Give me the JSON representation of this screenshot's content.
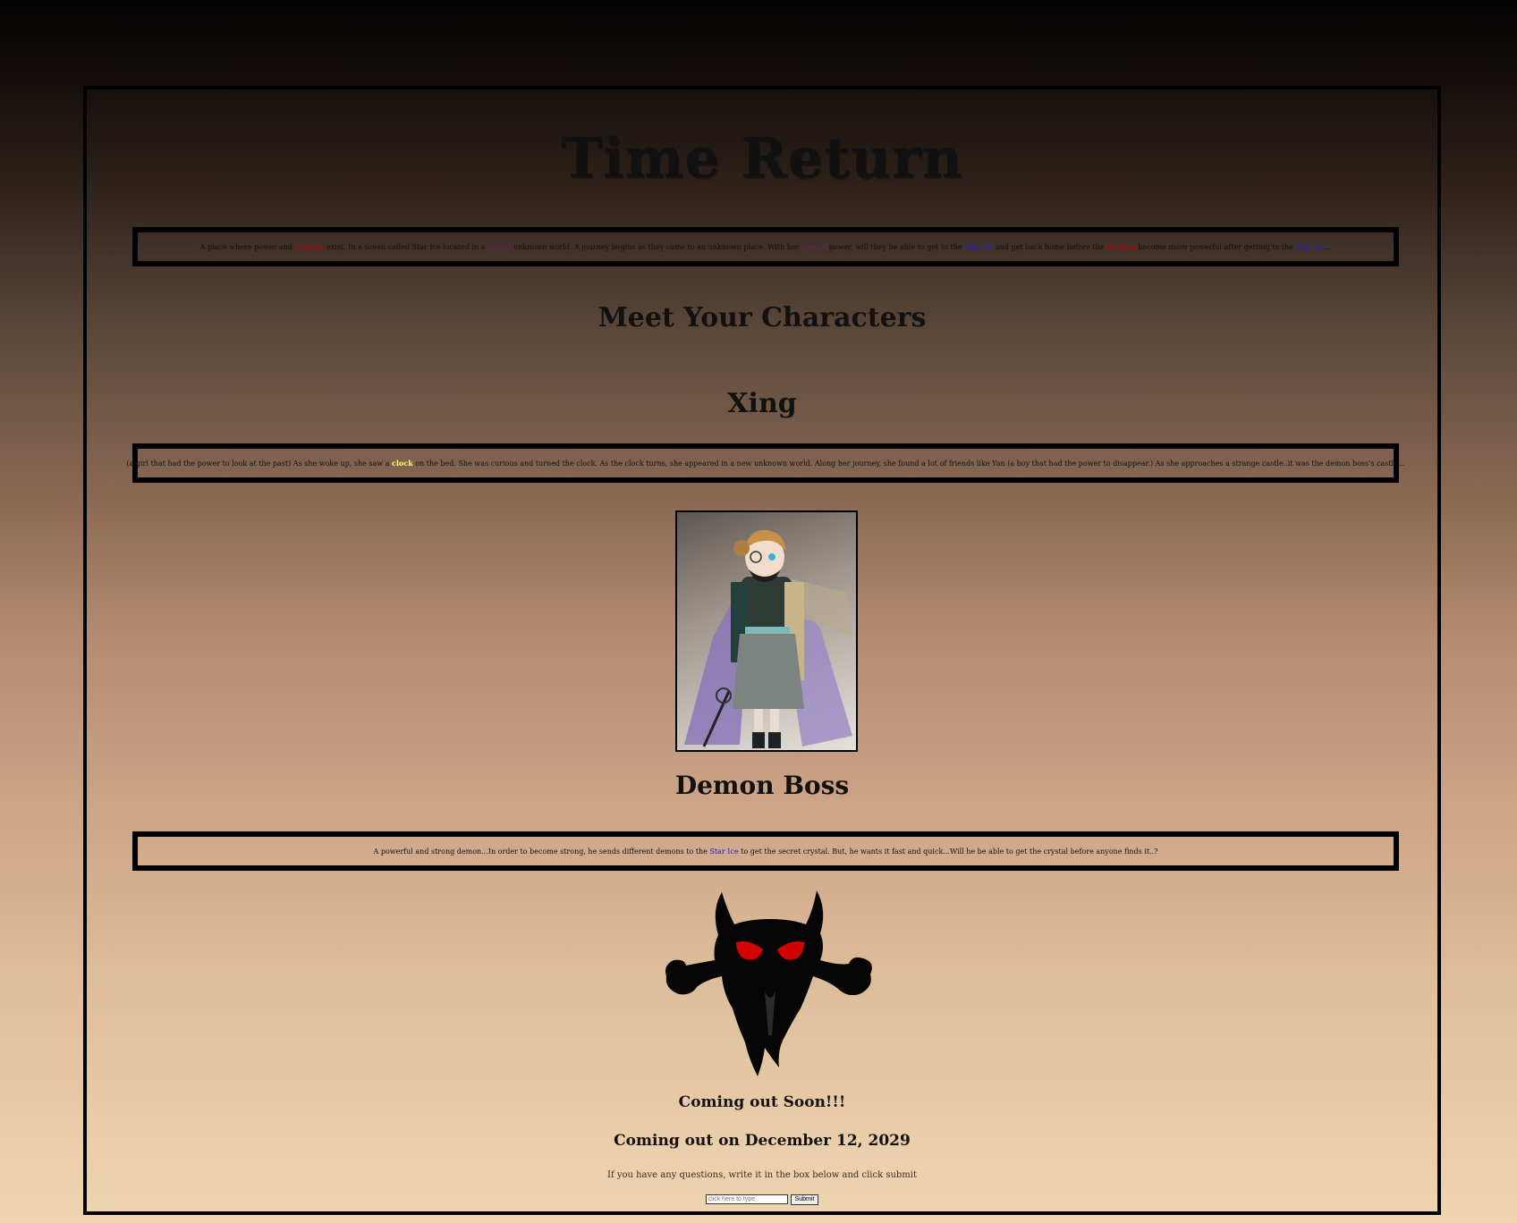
{
  "title": "Time Return",
  "intro": {
    "t1": "A place where power and ",
    "w_red1": "Demons",
    "t2": " exist. In a ocean called Star Ice located in a ",
    "w_purple1": "purple",
    "t3": " unknown world. A journey begins as they came to an unknown place. With her ",
    "w_purple2": "special",
    "t4": " power, will they be able to get to the ",
    "w_blue1": "Star Ice",
    "t5": " and get back home before the ",
    "w_red2": "Demons",
    "t6": " become more powerful after getting to the ",
    "w_blue2": "Star Ice",
    "t7": "..."
  },
  "meet_heading": "Meet Your Characters",
  "xing": {
    "name": "Xing",
    "t1": "(a girl that had the power to look at the past) As she woke up, she saw a ",
    "w_yellow": "clock",
    "t2": " on the bed. She was curious and turned the clock. As the clock turns, she appeared in a new unknown world. Along her journey, she found a lot of friends like Yan (a boy that had the power to disappear.) As she approaches a strange castle..it was the demon boss's castle..."
  },
  "demon": {
    "name": "Demon Boss",
    "t1": "A powerful and strong demon...In order to become strong, he sends different demons to the ",
    "w_blue": "Star Ice",
    "t2": " to get the secret crystal. But, he wants it fast and quick...Will he be able to get the crystal before anyone finds it..?"
  },
  "coming_soon": "Coming out Soon!!!",
  "release": "Coming out on December 12, 2029",
  "questions_prompt": "If you have any questions, write it in the box below and click submit",
  "form": {
    "placeholder": "click here to type",
    "submit_label": "Submit"
  },
  "colors": {
    "accent_red": "#b00000",
    "accent_purple": "#6a1b6a",
    "accent_blue": "#1c1cd0",
    "accent_yellow": "#ffff66"
  }
}
